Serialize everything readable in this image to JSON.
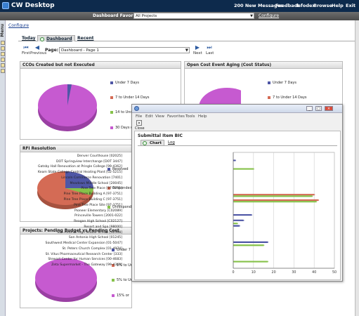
{
  "topbar": {
    "title": "CW Desktop",
    "links": [
      "200 New Messages",
      "Feedback",
      "Infodex",
      "Browse",
      "Help",
      "Exit"
    ]
  },
  "favorites": {
    "label": "Dashboard Favorites",
    "selected": "All Projects",
    "configure": "Configure"
  },
  "menu": {
    "label": "Menu"
  },
  "configure_link": "Configure",
  "tabs": [
    "Today",
    "Dashboard",
    "Recent"
  ],
  "page_nav": {
    "first": "First",
    "previous": "Previous",
    "page_label": "Page:",
    "page_value": "Dashboard - Page 1",
    "next": "Next",
    "last": "Last"
  },
  "colors": {
    "blue": "#4f57a6",
    "salmon": "#d46b55",
    "green": "#86c24a",
    "magenta": "#c65ad0"
  },
  "panels": {
    "cco": {
      "title": "CCOs Created but not Executed",
      "legend": [
        "Under 7 Days",
        "7 to Under 14 Days",
        "14 to Und",
        "30 Days o"
      ]
    },
    "open_cost": {
      "title": "Open Cost Event Aging (Cost Status)",
      "legend": [
        "Under 7 Days",
        "7 to Under 14 Days"
      ]
    },
    "rfi": {
      "title": "RFI Resolution",
      "legend": [
        "Resolved",
        "Responded",
        "Unrespond"
      ]
    },
    "pending": {
      "title": "Projects: Pending Budget vs Pending Cost",
      "legend": [
        "Under 7",
        "1% to Un",
        "5% to Un",
        "15% or"
      ]
    }
  },
  "popup": {
    "menu": [
      "File",
      "Edit",
      "View",
      "Favorites",
      "Tools",
      "Help"
    ],
    "close": "Close",
    "title": "Submittal Item BIC",
    "tabs": [
      "Chart",
      "Log"
    ]
  },
  "chart_data": {
    "type": "bar",
    "orientation": "horizontal",
    "categories": [
      "Denver Courthouse [02025]",
      "DOT Springview Interchange [DOT 3447]",
      "Gatsby Hall Renovation at Pringle College [99-4362]",
      "Keam State College Central Heating Plant [02-5215]",
      "Lincoln Commerce Renovation [7401]",
      "Meadows Middle School [20045]",
      "Pine Tree Place [97-3751]",
      "Pine Tree Place Building A [97-3751]",
      "Pine Tree Place Building C [97-3751]",
      "Pine Tree Place Site [97-3751]",
      "Pioneer Elementary [C02089]",
      "Princeville Towers [2001-022]",
      "Reagan High School [C02127]",
      "Resort and Spa [98000]",
      "San Antonio High Middle School [32568]",
      "San Antonio High School [01245]",
      "Southwest Medical Center Expansion [01-5047]",
      "St. Peters Church Complex [01-4974]",
      "St. Vitus Pharmaceutical Research Center [333]",
      "Stewart Center for Human Services [00-4683]",
      "Zeta Supermarket - The Gateway [99-4369]"
    ],
    "series": [
      {
        "color": "#4f57a6",
        "values": [
          0,
          1,
          0,
          0,
          0,
          0,
          0,
          0,
          0,
          0,
          0,
          9,
          5,
          3,
          0,
          0,
          17,
          0,
          0,
          0,
          0
        ]
      },
      {
        "color": "#d46b55",
        "values": [
          0,
          0,
          0,
          0,
          0,
          0,
          0,
          40,
          42,
          0,
          0,
          0,
          0,
          0,
          0,
          0,
          0,
          0,
          0,
          0,
          0
        ]
      },
      {
        "color": "#86c24a",
        "values": [
          0,
          0,
          10,
          0,
          0,
          0,
          0,
          39,
          41,
          0,
          0,
          0,
          2,
          0,
          0,
          0,
          15,
          0,
          0,
          17,
          0
        ]
      }
    ],
    "xlim": [
      0,
      50
    ],
    "xticks": [
      0,
      10,
      20,
      30,
      40,
      50
    ],
    "grid": true
  }
}
